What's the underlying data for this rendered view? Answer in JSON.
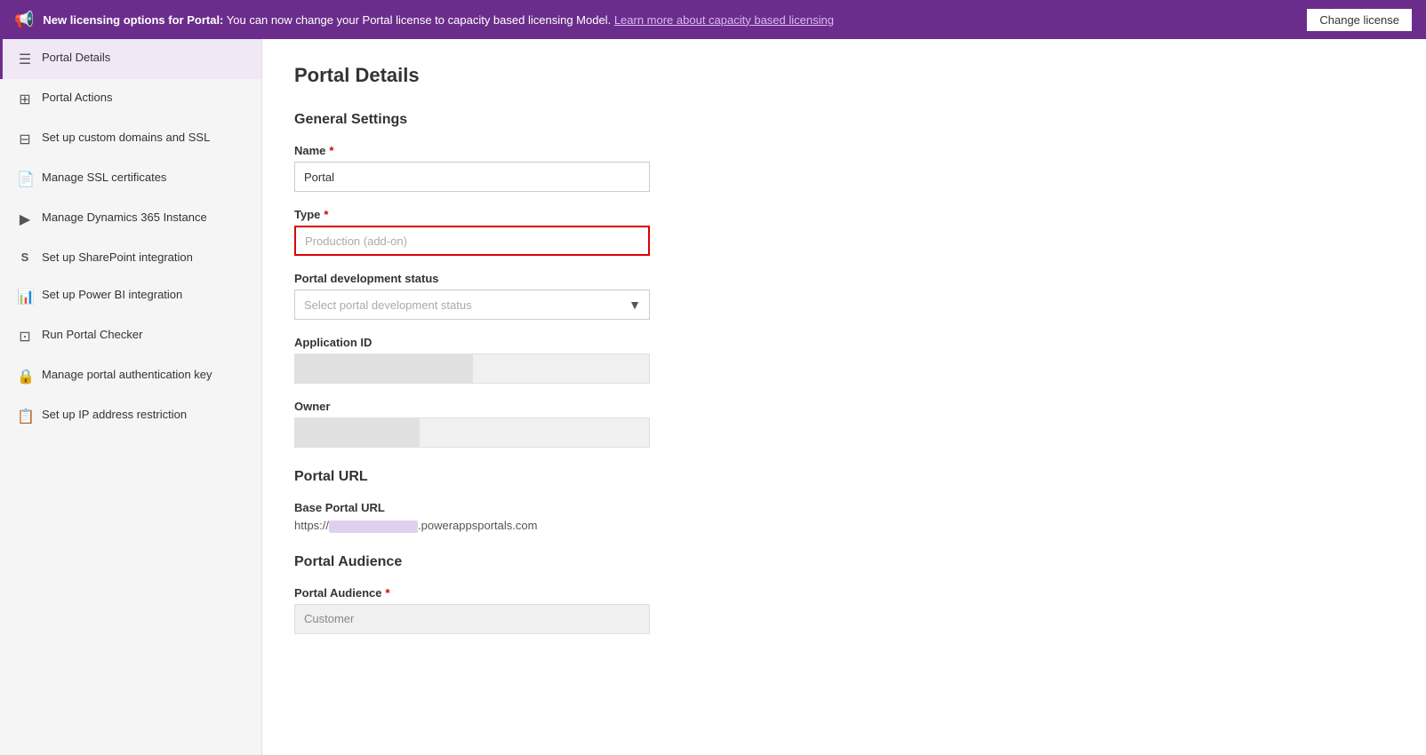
{
  "banner": {
    "icon": "📢",
    "text_prefix": "New licensing options for Portal:",
    "text_body": " You can now change your Portal license to capacity based licensing Model.",
    "link_text": "Learn more about capacity based licensing",
    "button_label": "Change license"
  },
  "sidebar": {
    "items": [
      {
        "id": "portal-details",
        "icon": "☰",
        "label": "Portal Details",
        "active": true
      },
      {
        "id": "portal-actions",
        "icon": "⊞",
        "label": "Portal Actions",
        "active": false
      },
      {
        "id": "custom-domains",
        "icon": "⊟",
        "label": "Set up custom domains and SSL",
        "active": false
      },
      {
        "id": "ssl-certificates",
        "icon": "📄",
        "label": "Manage SSL certificates",
        "active": false
      },
      {
        "id": "dynamics-instance",
        "icon": "▶",
        "label": "Manage Dynamics 365 Instance",
        "active": false
      },
      {
        "id": "sharepoint",
        "icon": "S",
        "label": "Set up SharePoint integration",
        "active": false
      },
      {
        "id": "power-bi",
        "icon": "📊",
        "label": "Set up Power BI integration",
        "active": false
      },
      {
        "id": "portal-checker",
        "icon": "⊡",
        "label": "Run Portal Checker",
        "active": false
      },
      {
        "id": "auth-key",
        "icon": "🔒",
        "label": "Manage portal authentication key",
        "active": false
      },
      {
        "id": "ip-restriction",
        "icon": "📋",
        "label": "Set up IP address restriction",
        "active": false
      }
    ]
  },
  "main": {
    "page_title": "Portal Details",
    "general_settings": {
      "section_title": "General Settings",
      "name_label": "Name",
      "name_required": "*",
      "name_placeholder": "Portal",
      "type_label": "Type",
      "type_required": "*",
      "type_placeholder": "Production (add-on)",
      "type_highlighted": true,
      "dev_status_label": "Portal development status",
      "dev_status_placeholder": "Select portal development status",
      "app_id_label": "Application ID",
      "owner_label": "Owner"
    },
    "portal_url": {
      "section_title": "Portal URL",
      "base_url_label": "Base Portal URL",
      "base_url_prefix": "https://",
      "base_url_suffix": ".powerappsportals.com"
    },
    "portal_audience": {
      "section_title": "Portal Audience",
      "audience_label": "Portal Audience",
      "audience_required": "*",
      "audience_value": "Customer"
    }
  }
}
